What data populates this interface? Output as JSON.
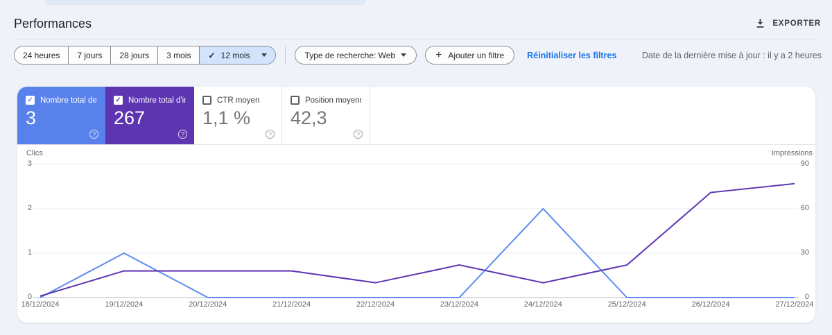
{
  "header": {
    "title": "Performances",
    "export_label": "EXPORTER"
  },
  "filters": {
    "periods": [
      "24 heures",
      "7 jours",
      "28 jours",
      "3 mois"
    ],
    "selected_period": "12 mois",
    "search_type": "Type de recherche: Web",
    "add_filter": "Ajouter un filtre",
    "reset": "Réinitialiser les filtres",
    "last_update": "Date de la dernière mise à jour : il y a 2 heures"
  },
  "metrics": {
    "cards": [
      {
        "label": "Nombre total de c...",
        "value": "3",
        "selected": true,
        "color": "#5881eb"
      },
      {
        "label": "Nombre total d'im...",
        "value": "267",
        "selected": true,
        "color": "#5e35b1"
      },
      {
        "label": "CTR moyen",
        "value": "1,1 %",
        "selected": false,
        "color": null
      },
      {
        "label": "Position moyenne",
        "value": "42,3",
        "selected": false,
        "color": null
      }
    ]
  },
  "chart_data": {
    "type": "line",
    "categories": [
      "18/12/2024",
      "19/12/2024",
      "20/12/2024",
      "21/12/2024",
      "22/12/2024",
      "23/12/2024",
      "24/12/2024",
      "25/12/2024",
      "26/12/2024",
      "27/12/2024"
    ],
    "series": [
      {
        "name": "Clics",
        "axis": "left",
        "color": "#5e8bf2",
        "values": [
          0,
          1,
          0,
          0,
          0,
          0,
          2,
          0,
          0,
          0
        ]
      },
      {
        "name": "Impressions",
        "axis": "right",
        "color": "#5e35b1",
        "values": [
          1,
          18,
          18,
          18,
          10,
          22,
          10,
          22,
          71,
          77
        ]
      }
    ],
    "left_axis": {
      "label": "Clics",
      "ticks": [
        0,
        1,
        2,
        3
      ],
      "max": 3
    },
    "right_axis": {
      "label": "Impressions",
      "ticks": [
        0,
        30,
        60,
        90
      ],
      "max": 90
    },
    "grid": "horizontal",
    "legend": "none"
  }
}
